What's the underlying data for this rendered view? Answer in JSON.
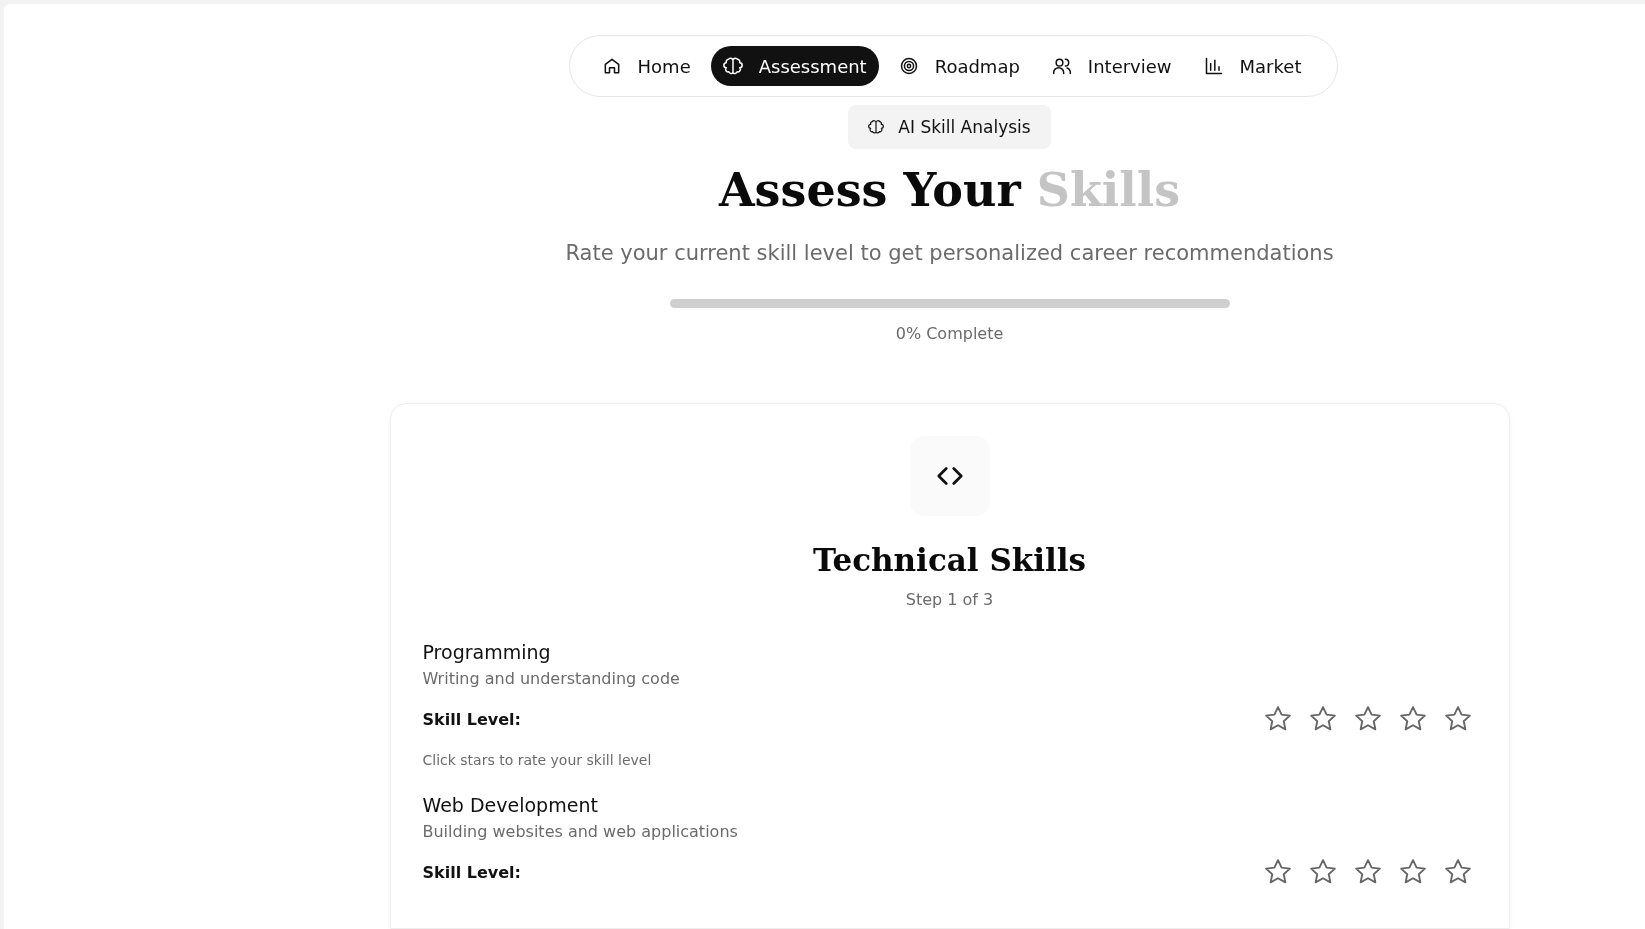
{
  "nav": [
    {
      "label": "Home",
      "kind": "home",
      "selected": false
    },
    {
      "label": "Assessment",
      "kind": "brain",
      "selected": true
    },
    {
      "label": "Roadmap",
      "kind": "target",
      "selected": false
    },
    {
      "label": "Interview",
      "kind": "users",
      "selected": false
    },
    {
      "label": "Market",
      "kind": "chart",
      "selected": false
    }
  ],
  "badge": {
    "label": "AI Skill Analysis"
  },
  "heading": {
    "main": "Assess Your",
    "accent": "Skills"
  },
  "subtitle": "Rate your current skill level to get personalized career recommendations",
  "progress": {
    "level": 0,
    "caption": "0% Complete"
  },
  "section": {
    "title": "Technical Skills",
    "step": "Step 1 of 3",
    "skills": [
      {
        "name": "Programming",
        "description": "Writing and understanding code",
        "rating_label": "Skill Level:",
        "stars": 0,
        "hint": "Click stars to rate your skill level"
      },
      {
        "name": "Web Development",
        "description": "Building websites and web applications",
        "rating_label": "Skill Level:",
        "stars": 0
      }
    ]
  }
}
